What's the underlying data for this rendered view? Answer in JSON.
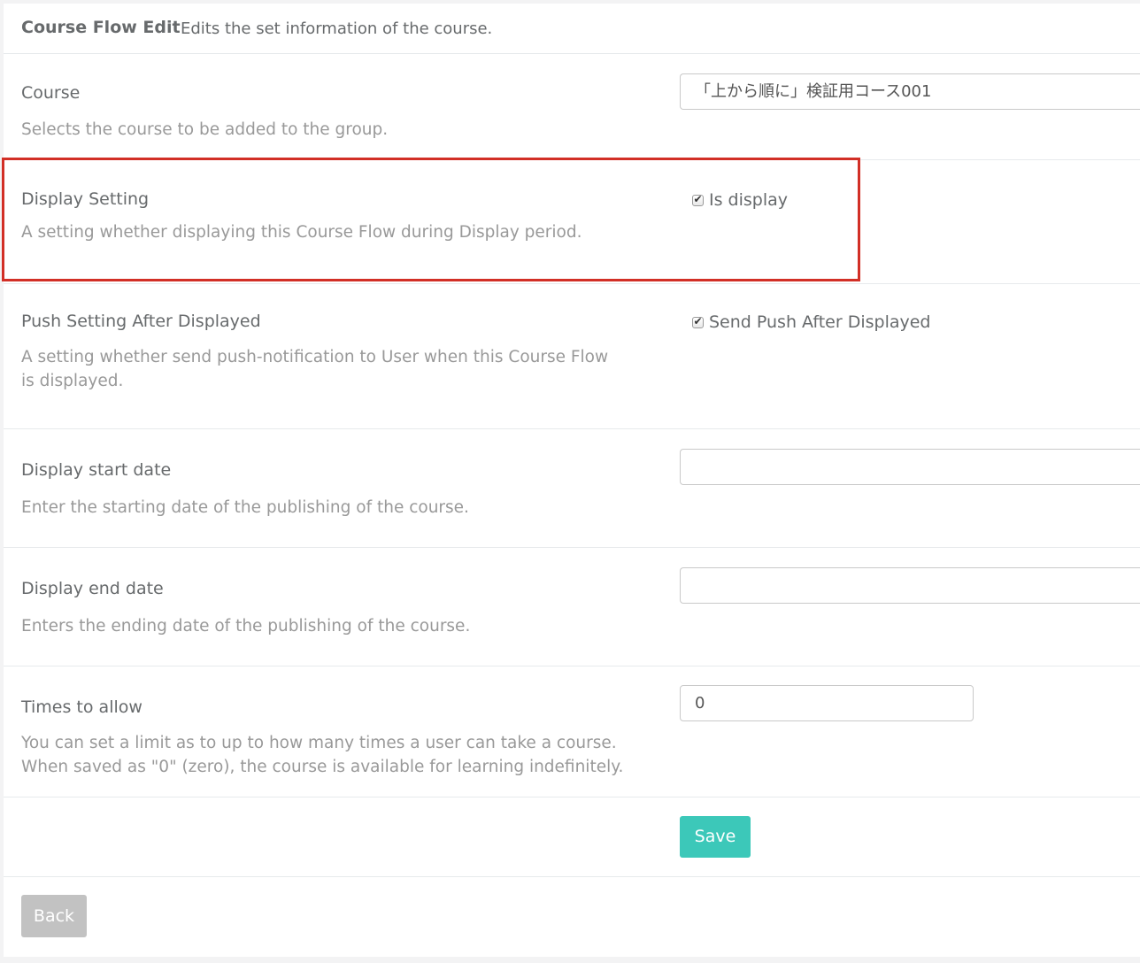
{
  "header": {
    "title": "Course Flow Edit",
    "subtitle": "Edits the set information of the course."
  },
  "fields": {
    "course": {
      "label": "Course",
      "description": "Selects the course to be added to the group.",
      "value": "「上から順に」検証用コース001"
    },
    "display_setting": {
      "label": "Display Setting",
      "description": "A setting whether displaying this Course Flow during Display period.",
      "checkbox_label": "Is display",
      "checked": true
    },
    "push_setting": {
      "label": "Push Setting After Displayed",
      "description": "A setting whether send push-notification to User when this Course Flow is displayed.",
      "checkbox_label": "Send Push After Displayed",
      "checked": true
    },
    "display_start_date": {
      "label": "Display start date",
      "description": "Enter the starting date of the publishing of the course.",
      "value": ""
    },
    "display_end_date": {
      "label": "Display end date",
      "description": "Enters the ending date of the publishing of the course.",
      "value": ""
    },
    "times_to_allow": {
      "label": "Times to allow",
      "description": "You can set a limit as to up to how many times a user can take a course. When saved as \"0\" (zero), the course is available for learning indefinitely.",
      "value": "0"
    }
  },
  "buttons": {
    "save": "Save",
    "back": "Back"
  },
  "colors": {
    "save_button": "#3cc8b9",
    "back_button": "#c2c2c2",
    "highlight_border": "#d22f26"
  },
  "icons": {
    "checkmark": "✔"
  }
}
